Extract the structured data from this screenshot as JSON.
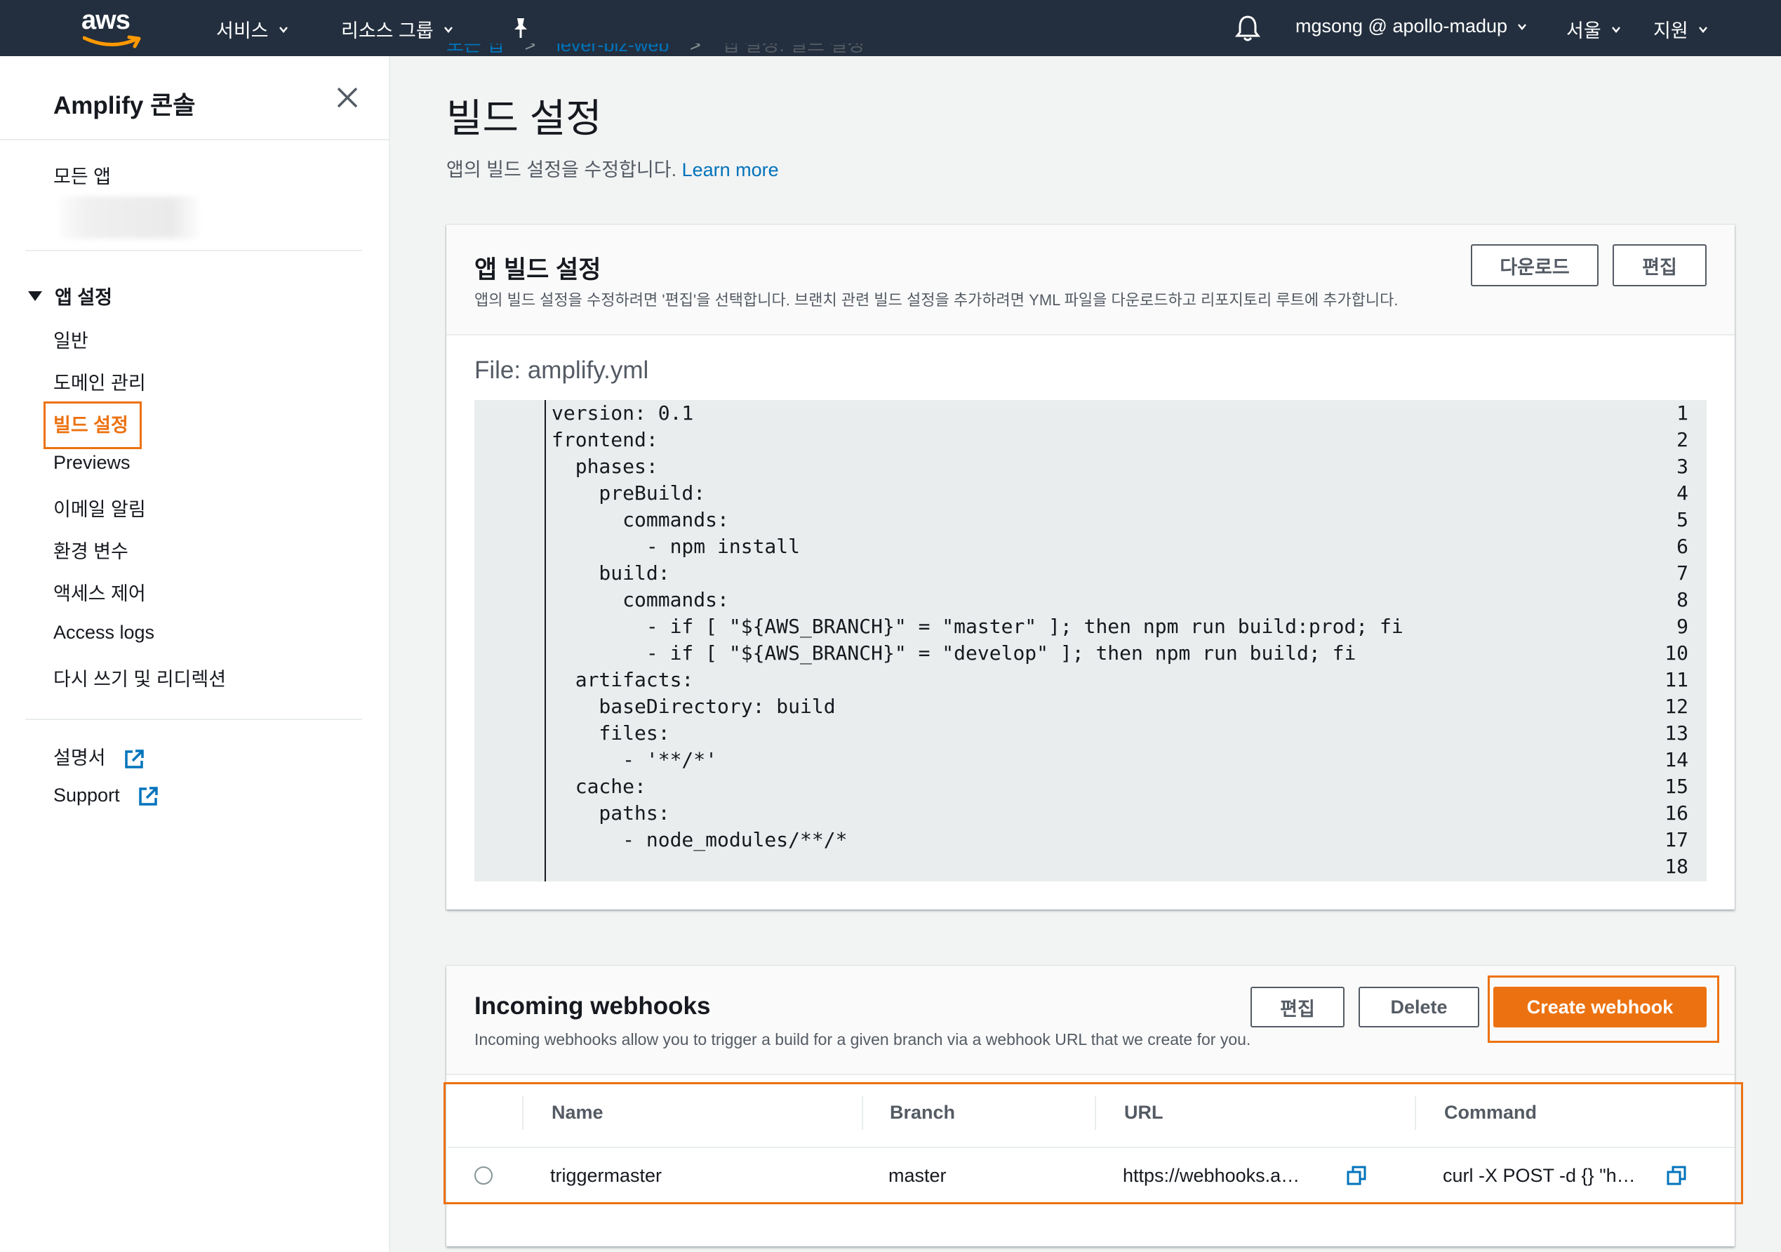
{
  "topnav": {
    "logo": "aws",
    "services": "서비스",
    "resource_groups": "리소스 그룹",
    "account": "mgsong @ apollo-madup",
    "region": "서울",
    "support": "지원"
  },
  "sidebar": {
    "title": "Amplify 콘솔",
    "all_apps": "모든 앱",
    "section": "앱 설정",
    "items": [
      "일반",
      "도메인 관리",
      "빌드 설정",
      "Previews",
      "이메일 알림",
      "환경 변수",
      "액세스 제어",
      "Access logs",
      "다시 쓰기 및 리디렉션"
    ],
    "docs": "설명서",
    "support": "Support"
  },
  "page": {
    "breadcrumb": [
      "모든 앱",
      "lever-biz-web",
      "앱 설정: 빌드 설정"
    ],
    "title": "빌드 설정",
    "description": "앱의 빌드 설정을 수정합니다.",
    "learn_more": "Learn more"
  },
  "build_card": {
    "title": "앱 빌드 설정",
    "description": "앱의 빌드 설정을 수정하려면 '편집'을 선택합니다. 브랜치 관련 빌드 설정을 추가하려면 YML 파일을 다운로드하고 리포지토리 루트에 추가합니다.",
    "download_button": "다운로드",
    "edit_button": "편집",
    "file_label": "File: amplify.yml",
    "code_lines": [
      "version: 0.1",
      "frontend:",
      "  phases:",
      "    preBuild:",
      "      commands:",
      "        - npm install",
      "    build:",
      "      commands:",
      "        - if [ \"${AWS_BRANCH}\" = \"master\" ]; then npm run build:prod; fi",
      "        - if [ \"${AWS_BRANCH}\" = \"develop\" ]; then npm run build; fi",
      "  artifacts:",
      "    baseDirectory: build",
      "    files:",
      "      - '**/*'",
      "  cache:",
      "    paths:",
      "      - node_modules/**/*",
      ""
    ]
  },
  "webhooks_card": {
    "title": "Incoming webhooks",
    "description": "Incoming webhooks allow you to trigger a build for a given branch via a webhook URL that we create for you.",
    "edit_button": "편집",
    "delete_button": "Delete",
    "create_button": "Create webhook",
    "columns": [
      "Name",
      "Branch",
      "URL",
      "Command"
    ],
    "rows": [
      {
        "name": "triggermaster",
        "branch": "master",
        "url": "https://webhooks.a…",
        "command": "curl -X POST -d {} \"h…"
      }
    ]
  },
  "colors": {
    "nav_bg": "#232f3e",
    "accent": "#ec7211",
    "link": "#0073bb"
  }
}
